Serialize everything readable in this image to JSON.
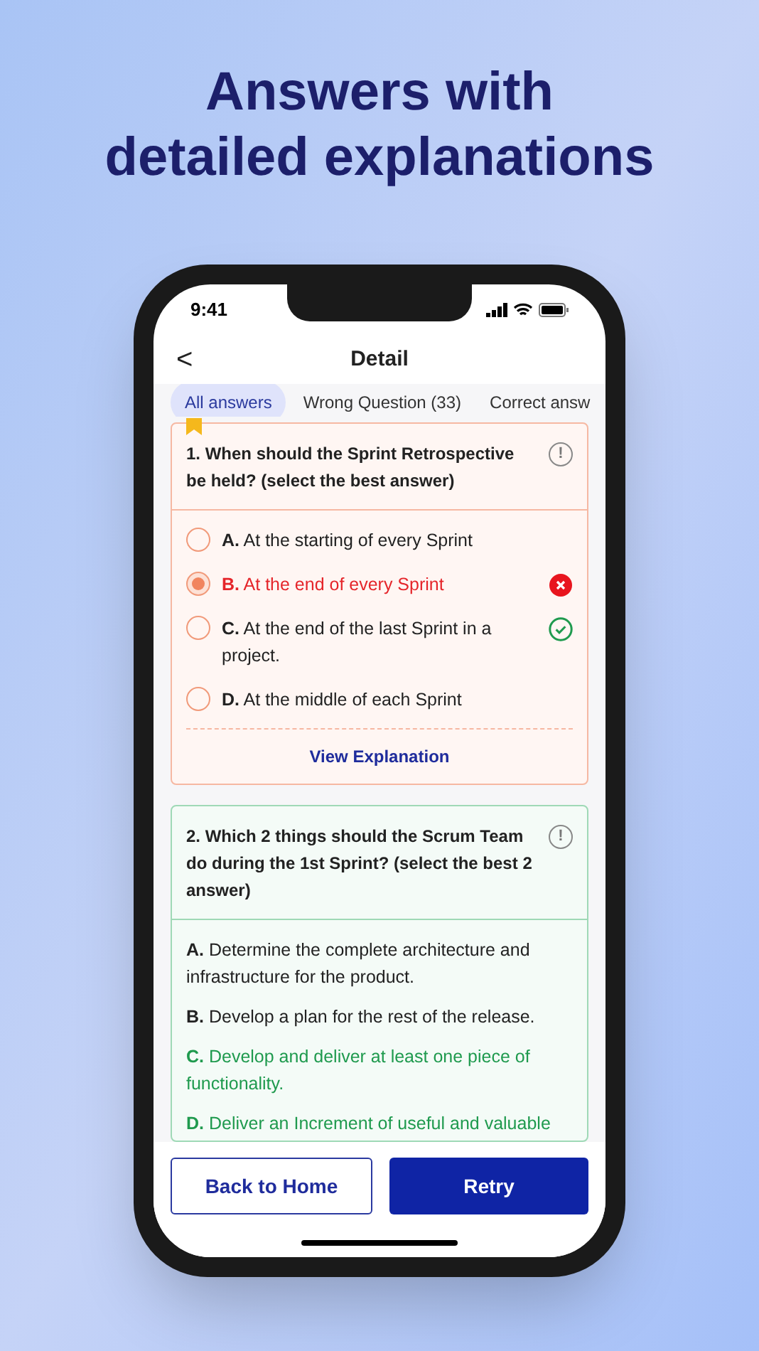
{
  "headline": [
    "Answers with",
    "detailed explanations"
  ],
  "status_bar": {
    "time": "9:41"
  },
  "header": {
    "back": "<",
    "title": "Detail"
  },
  "tabs": [
    {
      "label": "All answers",
      "selected": true
    },
    {
      "label": "Wrong Question (33)",
      "selected": false
    },
    {
      "label": "Correct answ",
      "selected": false
    }
  ],
  "questions": [
    {
      "kind": "single",
      "correct": false,
      "bookmarked": true,
      "text": "1. When should the Sprint Retrospective be held? (select the best answer)",
      "report": "!",
      "options": [
        {
          "text": "**A.** At the starting of every Sprint",
          "selected": false,
          "correct": false
        },
        {
          "text": "**B.** At the end of every Sprint",
          "selected": true,
          "correct": false
        },
        {
          "text": "**C.** At the end of the last Sprint in a project.",
          "selected": false,
          "correct": true
        },
        {
          "text": "**D.** At the middle of each Sprint",
          "selected": false,
          "correct": false
        }
      ],
      "link": "View Explanation"
    },
    {
      "kind": "multi",
      "correct": true,
      "bookmarked": false,
      "text": "2. Which 2 things should the Scrum Team do during the 1st Sprint? (select the best 2 answer)",
      "report": "!",
      "options": [
        {
          "text": "**A.** Determine the complete architecture and infrastructure for the product.",
          "correct": false
        },
        {
          "text": "**B.** Develop a plan for the rest of the release.",
          "correct": false
        },
        {
          "text": "**C.** Develop and deliver at least one piece of functionality.",
          "correct": true
        },
        {
          "text": "**D.** Deliver an Increment of useful and valuable",
          "correct": true
        }
      ]
    }
  ],
  "buttons": [
    {
      "label": "Back to Home",
      "kind": "outline"
    },
    {
      "label": "Retry",
      "kind": "filled"
    }
  ]
}
